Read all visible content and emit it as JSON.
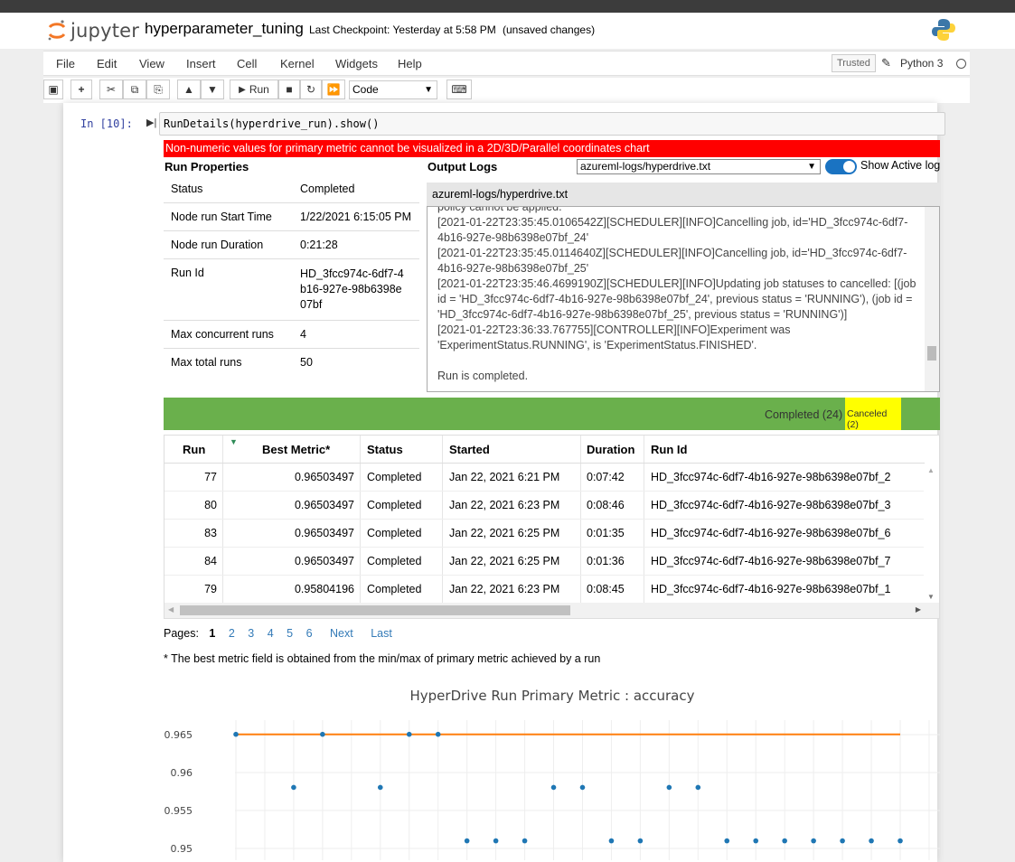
{
  "app": {
    "logo_text": "jupyter",
    "notebook_name": "hyperparameter_tuning",
    "checkpoint": "Last Checkpoint: Yesterday at 5:58 PM",
    "unsaved": "(unsaved changes)",
    "trusted": "Trusted",
    "kernel": "Python 3"
  },
  "menu": [
    "File",
    "Edit",
    "View",
    "Insert",
    "Cell",
    "Kernel",
    "Widgets",
    "Help"
  ],
  "toolbar": {
    "run_label": "Run",
    "cell_type": "Code"
  },
  "cell": {
    "prompt": "In [10]:",
    "code": "RunDetails(hyperdrive_run).show()"
  },
  "widget": {
    "warning": "Non-numeric values for primary metric cannot be visualized in a 2D/3D/Parallel coordinates chart",
    "run_props_title": "Run Properties",
    "output_logs_title": "Output Logs",
    "log_selected": "azureml-logs/hyperdrive.txt",
    "show_active_log": "Show Active log",
    "log_header": "azureml-logs/hyperdrive.txt",
    "properties": [
      {
        "key": "Status",
        "value": "Completed"
      },
      {
        "key": "Node run Start Time",
        "value": "1/22/2021 6:15:05 PM"
      },
      {
        "key": "Node run Duration",
        "value": "0:21:28"
      },
      {
        "key": "Run Id",
        "value": "HD_3fcc974c-6df7-4b16-927e-98b6398e07bf"
      },
      {
        "key": "Max concurrent runs",
        "value": "4"
      },
      {
        "key": "Max total runs",
        "value": "50"
      }
    ],
    "log_lines": [
      "policy cannot be applied.",
      "[2021-01-22T23:35:45.0106542Z][SCHEDULER][INFO]Cancelling job, id='HD_3fcc974c-6df7-4b16-927e-98b6398e07bf_24'",
      "[2021-01-22T23:35:45.0114640Z][SCHEDULER][INFO]Cancelling job, id='HD_3fcc974c-6df7-4b16-927e-98b6398e07bf_25'",
      "[2021-01-22T23:35:46.4699190Z][SCHEDULER][INFO]Updating job statuses to cancelled: [(job id = 'HD_3fcc974c-6df7-4b16-927e-98b6398e07bf_24', previous status = 'RUNNING'), (job id = 'HD_3fcc974c-6df7-4b16-927e-98b6398e07bf_25', previous status = 'RUNNING')]",
      "[2021-01-22T23:36:33.767755][CONTROLLER][INFO]Experiment was 'ExperimentStatus.RUNNING', is 'ExperimentStatus.FINISHED'.",
      "",
      "Run is completed."
    ],
    "status_completed": "Completed (24)",
    "status_canceled": "Canceled (2)",
    "columns": [
      "Run",
      "Best Metric*",
      "Status",
      "Started",
      "Duration",
      "Run Id"
    ],
    "rows": [
      {
        "run": "77",
        "metric": "0.96503497",
        "status": "Completed",
        "started": "Jan 22, 2021 6:21 PM",
        "duration": "0:07:42",
        "run_id": "HD_3fcc974c-6df7-4b16-927e-98b6398e07bf_2"
      },
      {
        "run": "80",
        "metric": "0.96503497",
        "status": "Completed",
        "started": "Jan 22, 2021 6:23 PM",
        "duration": "0:08:46",
        "run_id": "HD_3fcc974c-6df7-4b16-927e-98b6398e07bf_3"
      },
      {
        "run": "83",
        "metric": "0.96503497",
        "status": "Completed",
        "started": "Jan 22, 2021 6:25 PM",
        "duration": "0:01:35",
        "run_id": "HD_3fcc974c-6df7-4b16-927e-98b6398e07bf_6"
      },
      {
        "run": "84",
        "metric": "0.96503497",
        "status": "Completed",
        "started": "Jan 22, 2021 6:25 PM",
        "duration": "0:01:36",
        "run_id": "HD_3fcc974c-6df7-4b16-927e-98b6398e07bf_7"
      },
      {
        "run": "79",
        "metric": "0.95804196",
        "status": "Completed",
        "started": "Jan 22, 2021 6:23 PM",
        "duration": "0:08:45",
        "run_id": "HD_3fcc974c-6df7-4b16-927e-98b6398e07bf_1"
      }
    ],
    "pages_label": "Pages:",
    "pages": [
      "1",
      "2",
      "3",
      "4",
      "5",
      "6"
    ],
    "next": "Next",
    "last": "Last",
    "note": "* The best metric field is obtained from the min/max of primary metric achieved by a run"
  },
  "colors": {
    "warning_bg": "#ff0000",
    "completed": "#6ab04c",
    "canceled": "#ffff00",
    "point": "#1f77b4",
    "best_line": "#ff7f0e"
  },
  "chart_data": {
    "type": "scatter",
    "title": "HyperDrive Run Primary Metric : accuracy",
    "y_ticks": [
      "0.965",
      "0.96",
      "0.955",
      "0.95"
    ],
    "ylim_visible": [
      0.949,
      0.966
    ],
    "series": [
      {
        "x": [
          0,
          2,
          3,
          5,
          6,
          7,
          8,
          9,
          10,
          11,
          12,
          13,
          14,
          15,
          16,
          17,
          18,
          19,
          20,
          21,
          22,
          23
        ],
        "y": [
          0.96503497,
          0.95804196,
          0.96503497,
          0.95804196,
          0.96503497,
          0.96503497,
          0.951,
          0.951,
          0.951,
          0.95804196,
          0.95804196,
          0.951,
          0.951,
          0.95804196,
          0.95804196,
          0.951,
          0.951,
          0.951,
          0.951,
          0.951,
          0.951,
          0.951
        ]
      }
    ],
    "best_line": {
      "x": [
        0,
        23
      ],
      "y": [
        0.96503497,
        0.96503497
      ]
    }
  }
}
